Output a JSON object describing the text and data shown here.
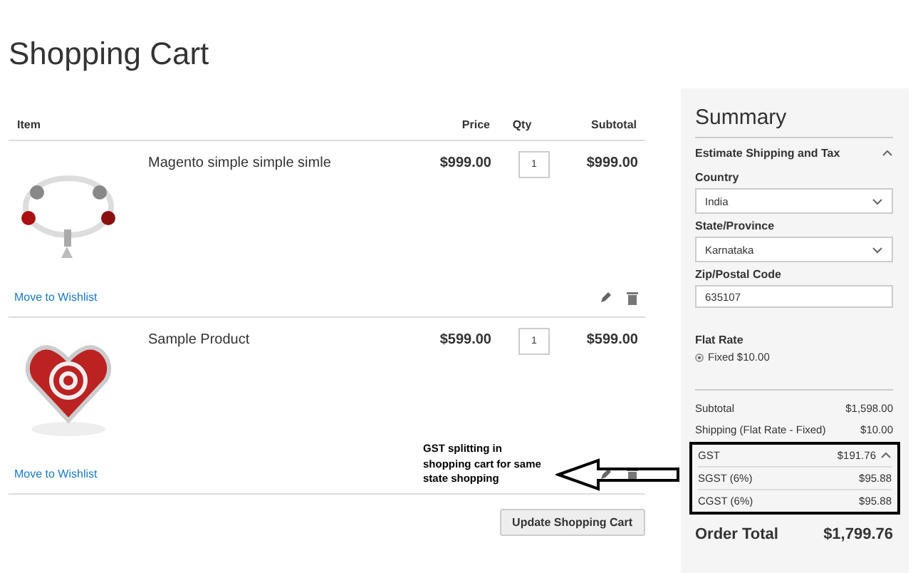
{
  "page_title": "Shopping Cart",
  "table": {
    "columns": [
      "Item",
      "Price",
      "Qty",
      "Subtotal"
    ],
    "rows": [
      {
        "name": "Magento simple simple simle",
        "price": "$999.00",
        "qty": "1",
        "subtotal": "$999.00",
        "wishlist_link": "Move to Wishlist"
      },
      {
        "name": "Sample Product",
        "price": "$599.00",
        "qty": "1",
        "subtotal": "$599.00",
        "wishlist_link": "Move to Wishlist"
      }
    ]
  },
  "update_button": "Update Shopping Cart",
  "summary": {
    "title": "Summary",
    "estimate": {
      "heading": "Estimate Shipping and Tax",
      "expanded": true,
      "fields": [
        {
          "kind": "select",
          "label": "Country",
          "value": "India"
        },
        {
          "kind": "select",
          "label": "State/Province",
          "value": "Karnataka"
        },
        {
          "kind": "input",
          "label": "Zip/Postal Code",
          "value": "635107"
        }
      ],
      "method_title": "Flat Rate",
      "methods": [
        {
          "label": "Fixed $10.00",
          "selected": true
        }
      ]
    },
    "totals": [
      {
        "label": "Subtotal",
        "value": "$1,598.00"
      },
      {
        "label": "Shipping (Flat Rate - Fixed)",
        "value": "$10.00"
      }
    ],
    "tax": {
      "label": "GST",
      "value": "$191.76",
      "expanded": true,
      "parts": [
        {
          "label": "SGST (6%)",
          "value": "$95.88"
        },
        {
          "label": "CGST (6%)",
          "value": "$95.88"
        }
      ]
    },
    "order_total": {
      "label": "Order Total",
      "value": "$1,799.76"
    }
  },
  "annotation": {
    "text": "GST splitting in shopping cart for same state shopping"
  }
}
